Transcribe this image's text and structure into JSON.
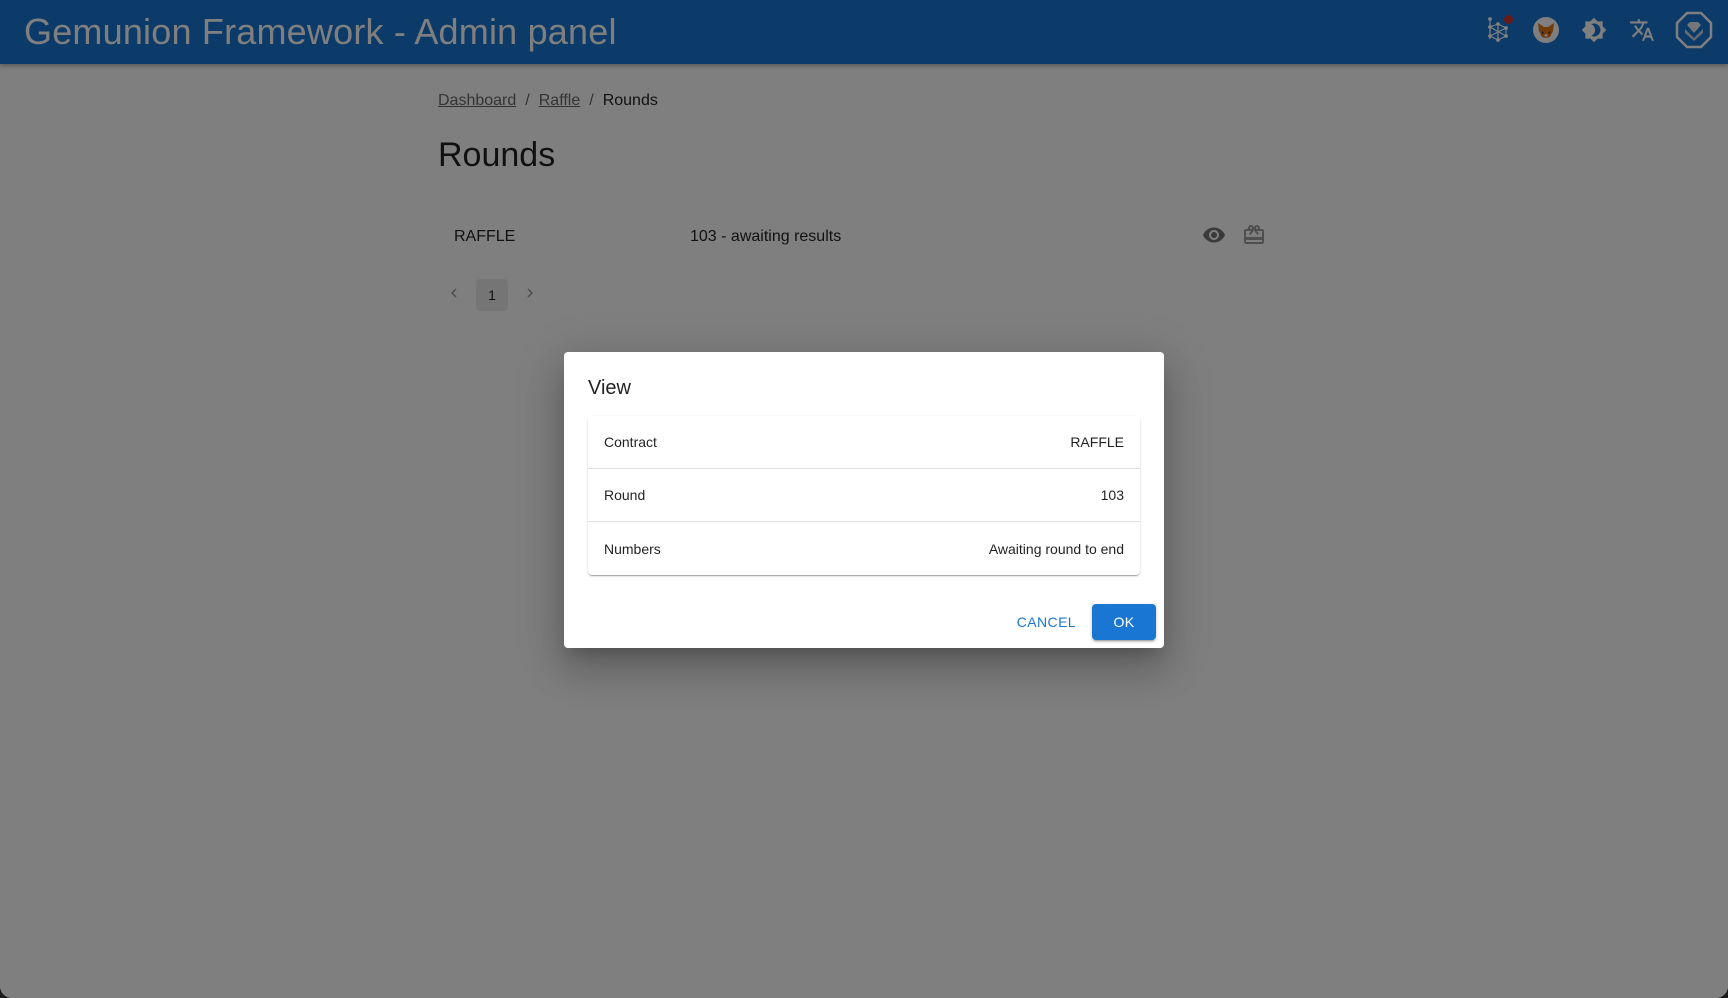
{
  "appbar": {
    "title": "Gemunion Framework - Admin panel",
    "icons": [
      "network-icon",
      "metamask-fox-icon",
      "theme-toggle-icon",
      "translate-icon",
      "profile-gem-icon"
    ],
    "notification_dot_color": "#d32f2f",
    "background_color": "#1976d2"
  },
  "breadcrumb": {
    "items": [
      {
        "label": "Dashboard",
        "link": true
      },
      {
        "label": "Raffle",
        "link": true
      },
      {
        "label": "Rounds",
        "link": false
      }
    ],
    "separator": "/"
  },
  "page": {
    "title": "Rounds"
  },
  "list": {
    "rows": [
      {
        "contract": "RAFFLE",
        "round": "103 - awaiting results",
        "actions": [
          "view-icon",
          "gift-icon"
        ]
      }
    ]
  },
  "pagination": {
    "current_page": "1",
    "prev_icon": "chevron-left",
    "next_icon": "chevron-right"
  },
  "dialog": {
    "title": "View",
    "rows": [
      {
        "label": "Contract",
        "value": "RAFFLE"
      },
      {
        "label": "Round",
        "value": "103"
      },
      {
        "label": "Numbers",
        "value": "Awaiting round to end"
      }
    ],
    "cancel_label": "CANCEL",
    "ok_label": "OK",
    "accent_color": "#1976d2"
  }
}
